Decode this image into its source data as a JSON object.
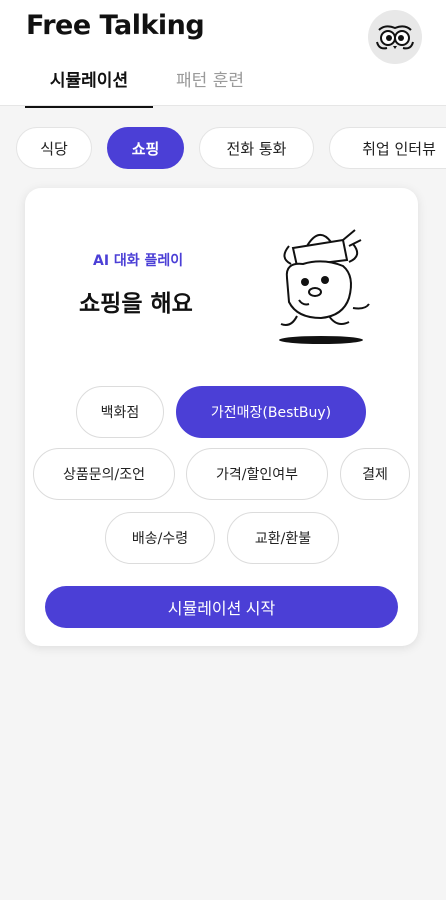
{
  "header": {
    "title": "Free Talking",
    "tabs": [
      {
        "label": "시뮬레이션",
        "active": true
      },
      {
        "label": "패턴 훈련",
        "active": false
      }
    ]
  },
  "categories": [
    {
      "label": "식당",
      "selected": false
    },
    {
      "label": "쇼핑",
      "selected": true
    },
    {
      "label": "전화 통화",
      "selected": false
    },
    {
      "label": "취업 인터뷰",
      "selected": false
    }
  ],
  "card": {
    "subtitle": "AI 대화 플레이",
    "title": "쇼핑을 해요",
    "options": [
      {
        "label": "백화점",
        "selected": false
      },
      {
        "label": "가전매장(BestBuy)",
        "selected": true
      },
      {
        "label": "상품문의/조언",
        "selected": false
      },
      {
        "label": "가격/할인여부",
        "selected": false
      },
      {
        "label": "결제",
        "selected": false
      },
      {
        "label": "배송/수령",
        "selected": false
      },
      {
        "label": "교환/환불",
        "selected": false
      }
    ],
    "start_label": "시뮬레이션 시작"
  },
  "colors": {
    "accent": "#4b3fd6",
    "background": "#f5f5f5",
    "card": "#ffffff"
  },
  "icons": {
    "avatar": "owl-avatar-icon",
    "illustration": "bear-carrying-bag-illustration"
  }
}
